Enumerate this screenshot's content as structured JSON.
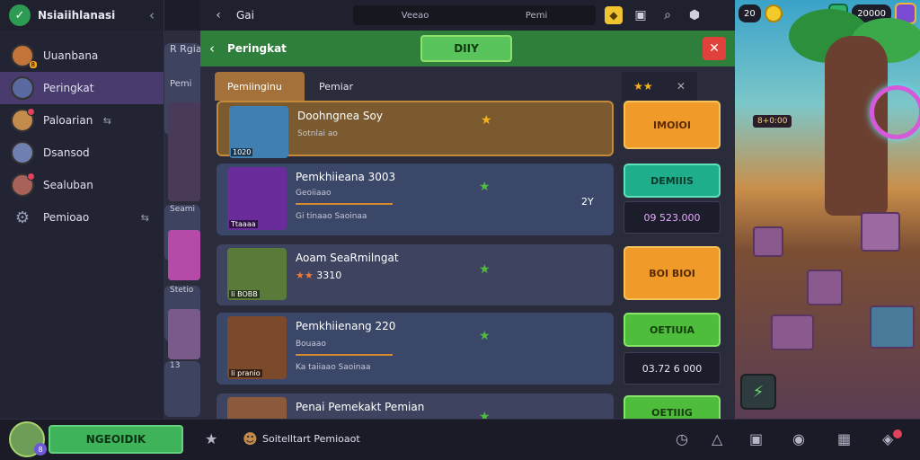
{
  "sidebar": {
    "title": "Nsiaiihlanasi",
    "items": [
      {
        "label": "Uuanbana",
        "badge": "8",
        "color": "#c2743a"
      },
      {
        "label": "Peringkat",
        "active": true,
        "color": "#5a6aa0"
      },
      {
        "label": "Paloarian",
        "tail": "⇆",
        "color": "#c48c4c"
      },
      {
        "label": "Dsansod",
        "color": "#6f7fb0"
      },
      {
        "label": "Sealuban",
        "color": "#a8625a"
      },
      {
        "label": "Pemioao",
        "tail": "⇆"
      }
    ]
  },
  "midstrip": {
    "labels": [
      "R Rgiak",
      "Pemi",
      "Seami",
      "Stetio",
      "13"
    ]
  },
  "topbar": {
    "title": "Gai",
    "search_left": "Veeao",
    "search_right": "Pemi"
  },
  "modal": {
    "title": "Peringkat",
    "pill": "DIIY",
    "tabs": [
      "Pemiinginu",
      "Pemiar"
    ],
    "rows": [
      {
        "title": "Doohngnea Soy",
        "sub": "Sotnlai ao",
        "caption": "1020",
        "star_color": "#f5b21a",
        "action": "IMOIOI",
        "action_style": "orange",
        "thumb_color": "#3f7fb2"
      },
      {
        "title": "Pemkhiieana  3003",
        "sub": "Geoiiaao",
        "sub2": "Gi tinaao  Saoinaa",
        "caption": "Ttaaaa",
        "star_color": "#4ebd3c",
        "extra": "2Y",
        "action": "DEMIIIS",
        "action_style": "teal",
        "price": "09 523.000",
        "thumb_color": "#6a2c9a"
      },
      {
        "title": "Aoam SeaRmilngat",
        "sub": "3310",
        "caption": "Ii BOBB",
        "star_color": "#4ebd3c",
        "action": "BOI BIOI",
        "action_style": "orange",
        "thumb_color": "#5a7a3a"
      },
      {
        "title": "Pemkhiienang  220",
        "sub": "Bouaao",
        "sub2": "Ka taiiaao  Saoinaa",
        "caption": "Ii pranio",
        "star_color": "#4ebd3c",
        "action": "OETIUIA",
        "action_style": "green",
        "price": "03.72 6 000",
        "thumb_color": "#7a4a2a"
      },
      {
        "title": "Penai Pemekakt Pemian",
        "sub": "",
        "caption": "",
        "star_color": "#4ebd3c",
        "action": "OETIIIG",
        "action_style": "green",
        "thumb_color": "#8a5a3a"
      }
    ]
  },
  "game": {
    "pill_left": "20",
    "pill_right": "20000",
    "labels": [
      "8+0:00"
    ]
  },
  "bottombar": {
    "button": "NGEOIDIK",
    "status": "Soitelltart Pemioaot",
    "avatar_badge": "8"
  },
  "colors": {
    "accent_green": "#2f7f3c",
    "active_sidebar": "#4a3b6e",
    "close_red": "#e0413b"
  }
}
